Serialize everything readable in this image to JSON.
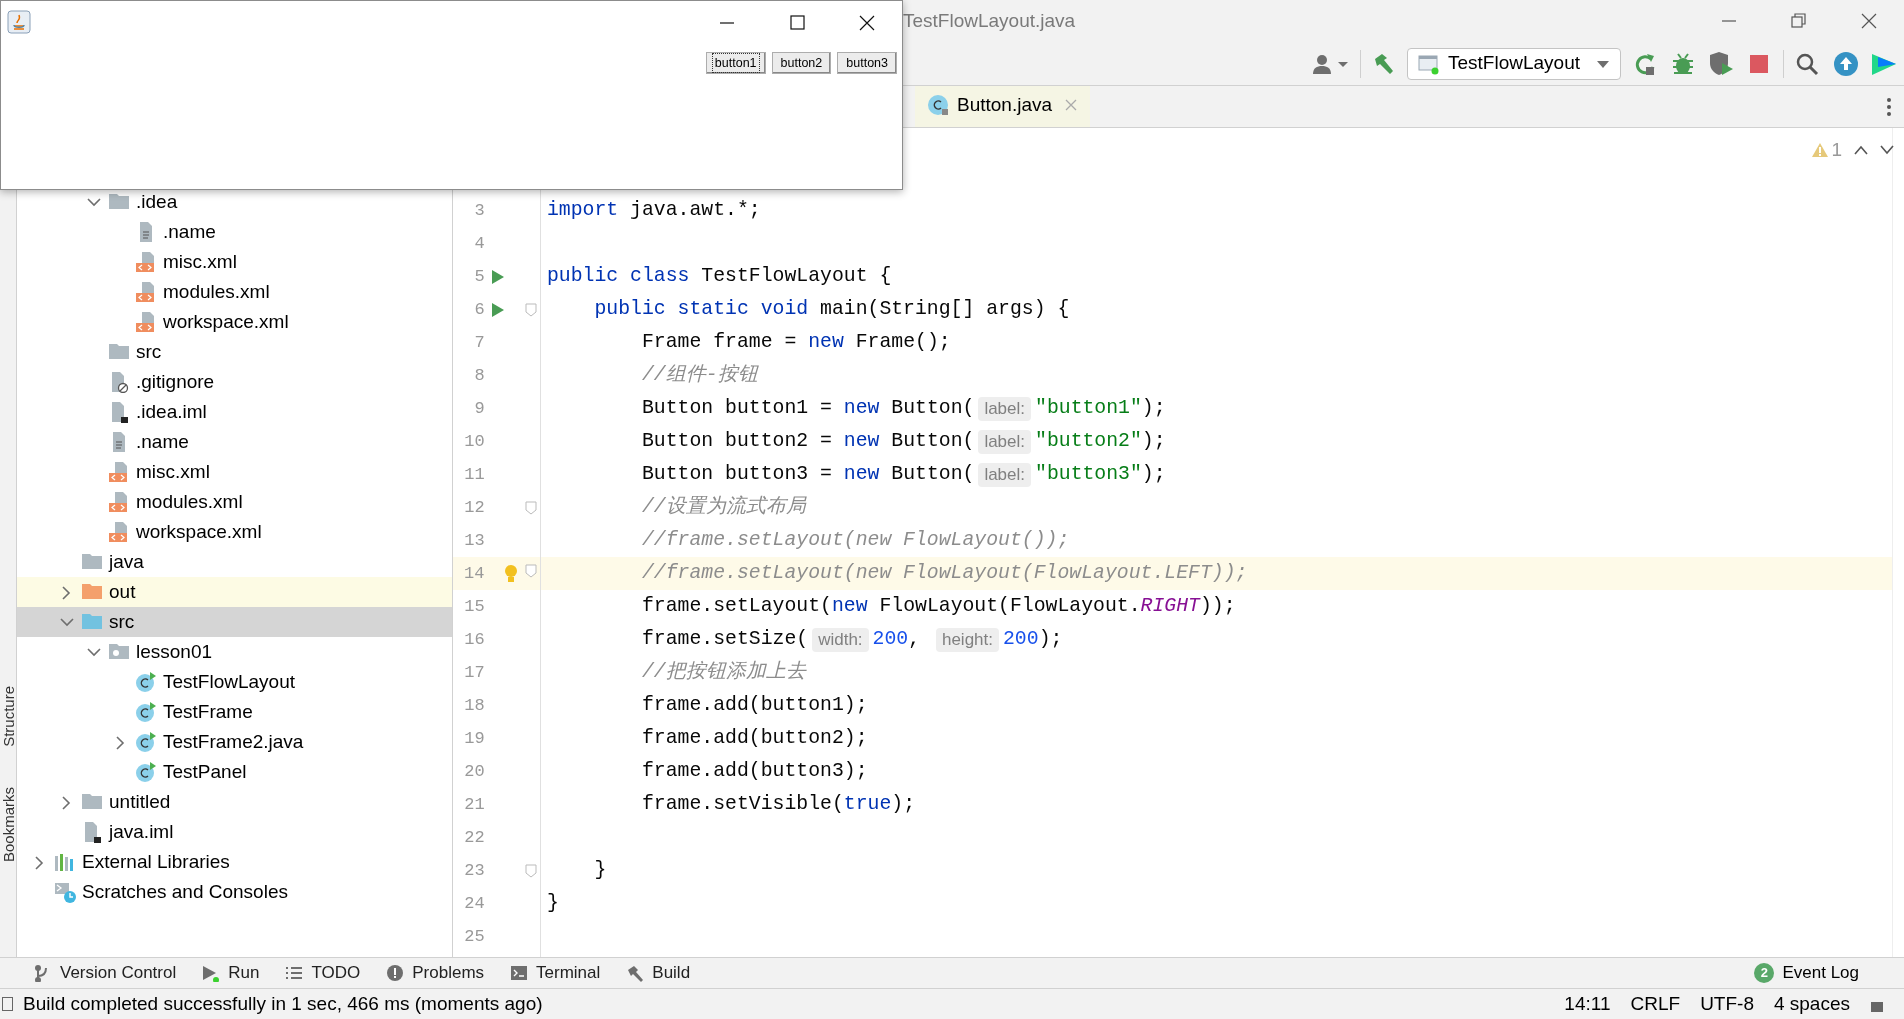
{
  "ide_title": "TestFlowLayout.java",
  "run_config": "TestFlowLayout",
  "editor_tabs": [
    {
      "label": "Button.java",
      "selected": true
    }
  ],
  "inspections": {
    "warnings": "1"
  },
  "side_labels": [
    "Structure",
    "Bookmarks"
  ],
  "tree": [
    {
      "children": [
        {
          "children": [
            {
              "label": ".idea",
              "kind": "folder",
              "expanded": true,
              "selected": false,
              "children": [
                {
                  "label": ".name",
                  "kind": "text",
                  "selected": false
                },
                {
                  "label": "misc.xml",
                  "kind": "xml",
                  "selected": false
                },
                {
                  "label": "modules.xml",
                  "kind": "xml",
                  "selected": false
                },
                {
                  "label": "workspace.xml",
                  "kind": "xml",
                  "selected": false
                }
              ]
            },
            {
              "label": "src",
              "kind": "folder",
              "selected": false
            },
            {
              "label": ".gitignore",
              "kind": "ignore",
              "selected": false
            },
            {
              "label": ".idea.iml",
              "kind": "iml",
              "selected": false
            },
            {
              "label": ".name",
              "kind": "text",
              "selected": false
            },
            {
              "label": "misc.xml",
              "kind": "xml",
              "selected": false
            },
            {
              "label": "modules.xml",
              "kind": "xml",
              "selected": false
            },
            {
              "label": "workspace.xml",
              "kind": "xml",
              "selected": false
            }
          ]
        },
        {
          "label": "java",
          "kind": "folder",
          "selected": false
        },
        {
          "label": "out",
          "kind": "excluded",
          "expanded": false,
          "selected": false
        },
        {
          "label": "src",
          "kind": "source",
          "expanded": true,
          "selected": true,
          "children": [
            {
              "label": "lesson01",
              "kind": "package",
              "expanded": true,
              "selected": false,
              "children": [
                {
                  "label": "TestFlowLayout",
                  "kind": "class",
                  "selected": false
                },
                {
                  "label": "TestFrame",
                  "kind": "class",
                  "selected": false
                },
                {
                  "label": "TestFrame2.java",
                  "kind": "class",
                  "expanded": false,
                  "selected": false
                },
                {
                  "label": "TestPanel",
                  "kind": "class",
                  "selected": false
                }
              ]
            }
          ]
        },
        {
          "label": "untitled",
          "kind": "folder",
          "expanded": false,
          "selected": false
        },
        {
          "label": "java.iml",
          "kind": "iml",
          "selected": false
        }
      ]
    },
    {
      "label": "External Libraries",
      "kind": "libraries",
      "expanded": false,
      "selected": false
    },
    {
      "label": "Scratches and Consoles",
      "kind": "scratches",
      "selected": false
    }
  ],
  "code_lines": [
    {
      "number": "3",
      "tokens": [
        {
          "kind": "keyword",
          "text": "import"
        },
        {
          "kind": "plain",
          "text": " java.awt.*;"
        }
      ]
    },
    {
      "number": "4"
    },
    {
      "number": "5",
      "run": true,
      "tokens": [
        {
          "kind": "keyword",
          "text": "public class"
        },
        {
          "kind": "plain",
          "text": " TestFlowLayout {"
        }
      ]
    },
    {
      "number": "6",
      "run": true,
      "fold": true,
      "tokens": [
        {
          "kind": "keyword",
          "text": "    public static void"
        },
        {
          "kind": "plain",
          "text": " main(String[] args) {"
        }
      ]
    },
    {
      "number": "7",
      "tokens": [
        {
          "kind": "plain",
          "text": "        Frame frame = "
        },
        {
          "kind": "keyword",
          "text": "new"
        },
        {
          "kind": "plain",
          "text": " Frame();"
        }
      ]
    },
    {
      "number": "8",
      "tokens": [
        {
          "kind": "comment",
          "text": "        //组件-按钮"
        }
      ]
    },
    {
      "number": "9",
      "tokens": [
        {
          "kind": "plain",
          "text": "        Button button1 = "
        },
        {
          "kind": "keyword",
          "text": "new"
        },
        {
          "kind": "plain",
          "text": " Button("
        },
        {
          "kind": "hint",
          "text": "label:"
        },
        {
          "kind": "string",
          "text": "\"button1\""
        },
        {
          "kind": "plain",
          "text": ");"
        }
      ]
    },
    {
      "number": "10",
      "tokens": [
        {
          "kind": "plain",
          "text": "        Button button2 = "
        },
        {
          "kind": "keyword",
          "text": "new"
        },
        {
          "kind": "plain",
          "text": " Button("
        },
        {
          "kind": "hint",
          "text": "label:"
        },
        {
          "kind": "string",
          "text": "\"button2\""
        },
        {
          "kind": "plain",
          "text": ");"
        }
      ]
    },
    {
      "number": "11",
      "tokens": [
        {
          "kind": "plain",
          "text": "        Button button3 = "
        },
        {
          "kind": "keyword",
          "text": "new"
        },
        {
          "kind": "plain",
          "text": " Button("
        },
        {
          "kind": "hint",
          "text": "label:"
        },
        {
          "kind": "string",
          "text": "\"button3\""
        },
        {
          "kind": "plain",
          "text": ");"
        }
      ]
    },
    {
      "number": "12",
      "fold": true,
      "tokens": [
        {
          "kind": "comment",
          "text": "        //设置为流式布局"
        }
      ]
    },
    {
      "number": "13",
      "tokens": [
        {
          "kind": "comment",
          "text": "        //frame.setLayout(new FlowLayout());"
        }
      ]
    },
    {
      "number": "14",
      "fold": true,
      "bulb": true,
      "current": true,
      "tokens": [
        {
          "kind": "comment",
          "text": "        //frame.setLayout(new FlowLayout(FlowLayout.LEFT));"
        }
      ]
    },
    {
      "number": "15",
      "tokens": [
        {
          "kind": "plain",
          "text": "        frame.setLayout("
        },
        {
          "kind": "keyword",
          "text": "new"
        },
        {
          "kind": "plain",
          "text": " FlowLayout(FlowLayout."
        },
        {
          "kind": "constant",
          "text": "RIGHT"
        },
        {
          "kind": "plain",
          "text": "));"
        }
      ]
    },
    {
      "number": "16",
      "tokens": [
        {
          "kind": "plain",
          "text": "        frame.setSize("
        },
        {
          "kind": "hint",
          "text": "width:"
        },
        {
          "kind": "number",
          "text": "200"
        },
        {
          "kind": "plain",
          "text": ", "
        },
        {
          "kind": "hint",
          "text": "height:"
        },
        {
          "kind": "number",
          "text": "200"
        },
        {
          "kind": "plain",
          "text": ");"
        }
      ]
    },
    {
      "number": "17",
      "tokens": [
        {
          "kind": "comment",
          "text": "        //把按钮添加上去"
        }
      ]
    },
    {
      "number": "18",
      "tokens": [
        {
          "kind": "plain",
          "text": "        frame.add(button1);"
        }
      ]
    },
    {
      "number": "19",
      "tokens": [
        {
          "kind": "plain",
          "text": "        frame.add(button2);"
        }
      ]
    },
    {
      "number": "20",
      "tokens": [
        {
          "kind": "plain",
          "text": "        frame.add(button3);"
        }
      ]
    },
    {
      "number": "21",
      "tokens": [
        {
          "kind": "plain",
          "text": "        frame.setVisible("
        },
        {
          "kind": "keyword",
          "text": "true"
        },
        {
          "kind": "plain",
          "text": ");"
        }
      ]
    },
    {
      "number": "22"
    },
    {
      "number": "23",
      "fold": true,
      "tokens": [
        {
          "kind": "plain",
          "text": "    }"
        }
      ]
    },
    {
      "number": "24",
      "tokens": [
        {
          "kind": "plain",
          "text": "}"
        }
      ]
    },
    {
      "number": "25"
    }
  ],
  "tool_windows": [
    {
      "label": "Version Control",
      "kind": "vcs"
    },
    {
      "label": "Run",
      "kind": "run"
    },
    {
      "label": "TODO",
      "kind": "todo"
    },
    {
      "label": "Problems",
      "kind": "problems"
    },
    {
      "label": "Terminal",
      "kind": "terminal"
    },
    {
      "label": "Build",
      "kind": "build"
    }
  ],
  "event_log": {
    "label": "Event Log",
    "count": "2"
  },
  "status_bar": {
    "message": "Build completed successfully in 1 sec, 466 ms (moments ago)",
    "items": [
      "14:11",
      "CRLF",
      "UTF-8",
      "4 spaces"
    ]
  },
  "java_window": {
    "buttons": [
      {
        "label": "button1",
        "focused": true
      },
      {
        "label": "button2",
        "focused": false
      },
      {
        "label": "button3",
        "focused": false
      }
    ]
  }
}
